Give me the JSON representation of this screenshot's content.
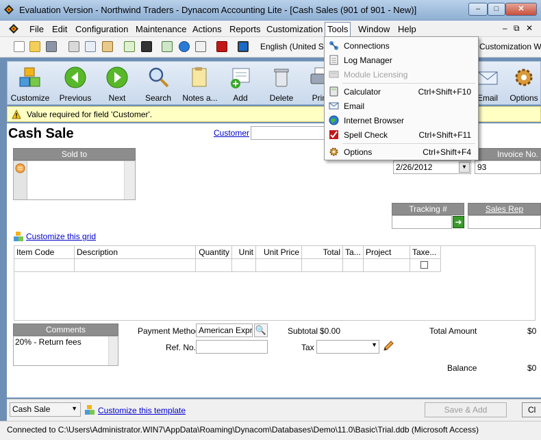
{
  "window": {
    "title": "Evaluation Version - Northwind Traders - Dynacom Accounting Lite - [Cash Sales (901 of 901 - New)]",
    "min_glyph": "–",
    "max_glyph": "□",
    "close_glyph": "✕"
  },
  "menubar": {
    "items": [
      "File",
      "Edit",
      "Configuration",
      "Maintenance",
      "Actions",
      "Reports",
      "Customization",
      "Tools",
      "Window",
      "Help"
    ],
    "active": "Tools",
    "mdi_minimize": "–",
    "mdi_restore": "⧉",
    "mdi_close": "✕"
  },
  "small_toolbar": {
    "language": "English (United States)",
    "customization_wizard": "Customization Wizard"
  },
  "big_toolbar": {
    "buttons": [
      {
        "label": "Customize",
        "icon": "cubes-icon"
      },
      {
        "label": "Previous",
        "icon": "arrow-left-icon"
      },
      {
        "label": "Next",
        "icon": "arrow-right-icon"
      },
      {
        "label": "Search",
        "icon": "magnifier-icon"
      },
      {
        "label": "Notes a...",
        "icon": "notes-icon"
      },
      {
        "label": "Add",
        "icon": "add-document-icon"
      },
      {
        "label": "Delete",
        "icon": "trash-icon"
      },
      {
        "label": "Print",
        "icon": "printer-icon"
      },
      {
        "label": "Email",
        "icon": "email-icon"
      },
      {
        "label": "Options",
        "icon": "gear-icon"
      }
    ]
  },
  "validation": {
    "message": "Value required for field 'Customer'."
  },
  "form": {
    "title": "Cash Sale",
    "customer_label": "Customer",
    "customer_value": "",
    "sold_to_header": "Sold to",
    "sold_to_value": "",
    "date_value": "2/26/2012",
    "invoice_header": "Invoice No.",
    "invoice_value": "93",
    "tracking_header": "Tracking #",
    "tracking_value": "",
    "sales_rep_header": "Sales Rep",
    "sales_rep_value": "",
    "customize_grid_link": "Customize this grid",
    "grid_columns": [
      "Item Code",
      "Description",
      "Quantity",
      "Unit",
      "Unit Price",
      "Total",
      "Ta...",
      "Project",
      "Taxe..."
    ],
    "comments_header": "Comments",
    "comments_value": "20% - Return fees",
    "payment_method_label": "Payment Method",
    "payment_method_value": "American Express",
    "ref_no_label": "Ref. No.",
    "ref_no_value": "",
    "subtotal_label": "Subtotal",
    "subtotal_value": "$0.00",
    "tax_label": "Tax",
    "tax_value": "",
    "total_amount_label": "Total Amount",
    "total_amount_value": "$0",
    "balance_label": "Balance",
    "balance_value": "$0"
  },
  "bottom": {
    "template_select": "Cash Sale",
    "customize_template_link": "Customize this template",
    "save_add_button": "Save & Add",
    "close_button": "Cl"
  },
  "status": {
    "text": "Connected to C:\\Users\\Administrator.WIN7\\AppData\\Roaming\\Dynacom\\Databases\\Demo\\11.0\\Basic\\Trial.ddb (Microsoft Access)"
  },
  "tools_menu": {
    "items": [
      {
        "label": "Connections",
        "shortcut": "",
        "icon": "connections-icon",
        "enabled": true
      },
      {
        "label": "Log Manager",
        "shortcut": "",
        "icon": "log-icon",
        "enabled": true
      },
      {
        "label": "Module Licensing",
        "shortcut": "",
        "icon": "license-icon",
        "enabled": false
      },
      {
        "label": "Calculator",
        "shortcut": "Ctrl+Shift+F10",
        "icon": "calculator-icon",
        "enabled": true
      },
      {
        "label": "Email",
        "shortcut": "",
        "icon": "email-icon",
        "enabled": true
      },
      {
        "label": "Internet Browser",
        "shortcut": "",
        "icon": "globe-icon",
        "enabled": true
      },
      {
        "label": "Spell Check",
        "shortcut": "Ctrl+Shift+F11",
        "icon": "spellcheck-icon",
        "enabled": true
      },
      {
        "label": "Options",
        "shortcut": "Ctrl+Shift+F4",
        "icon": "options-icon",
        "enabled": true
      }
    ]
  },
  "colors": {
    "accent_blue": "#0000cc",
    "header_gray": "#8d8d8d",
    "validation_yellow": "#ffffc4"
  }
}
